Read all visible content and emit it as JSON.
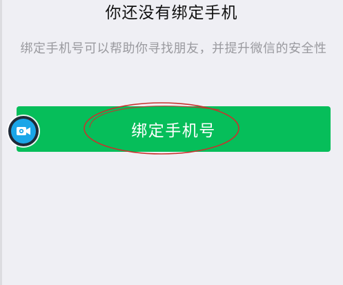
{
  "title": "你还没有绑定手机",
  "description": "绑定手机号可以帮助你寻找朋友，并提升微信的安全性",
  "bind_button_label": "绑定手机号",
  "colors": {
    "background": "#efeff4",
    "accent_green": "#06be5a",
    "annotation_red": "#c8322d",
    "camera_blue": "#1aa6e8"
  },
  "icons": {
    "floating_button": "video-camera-icon"
  }
}
